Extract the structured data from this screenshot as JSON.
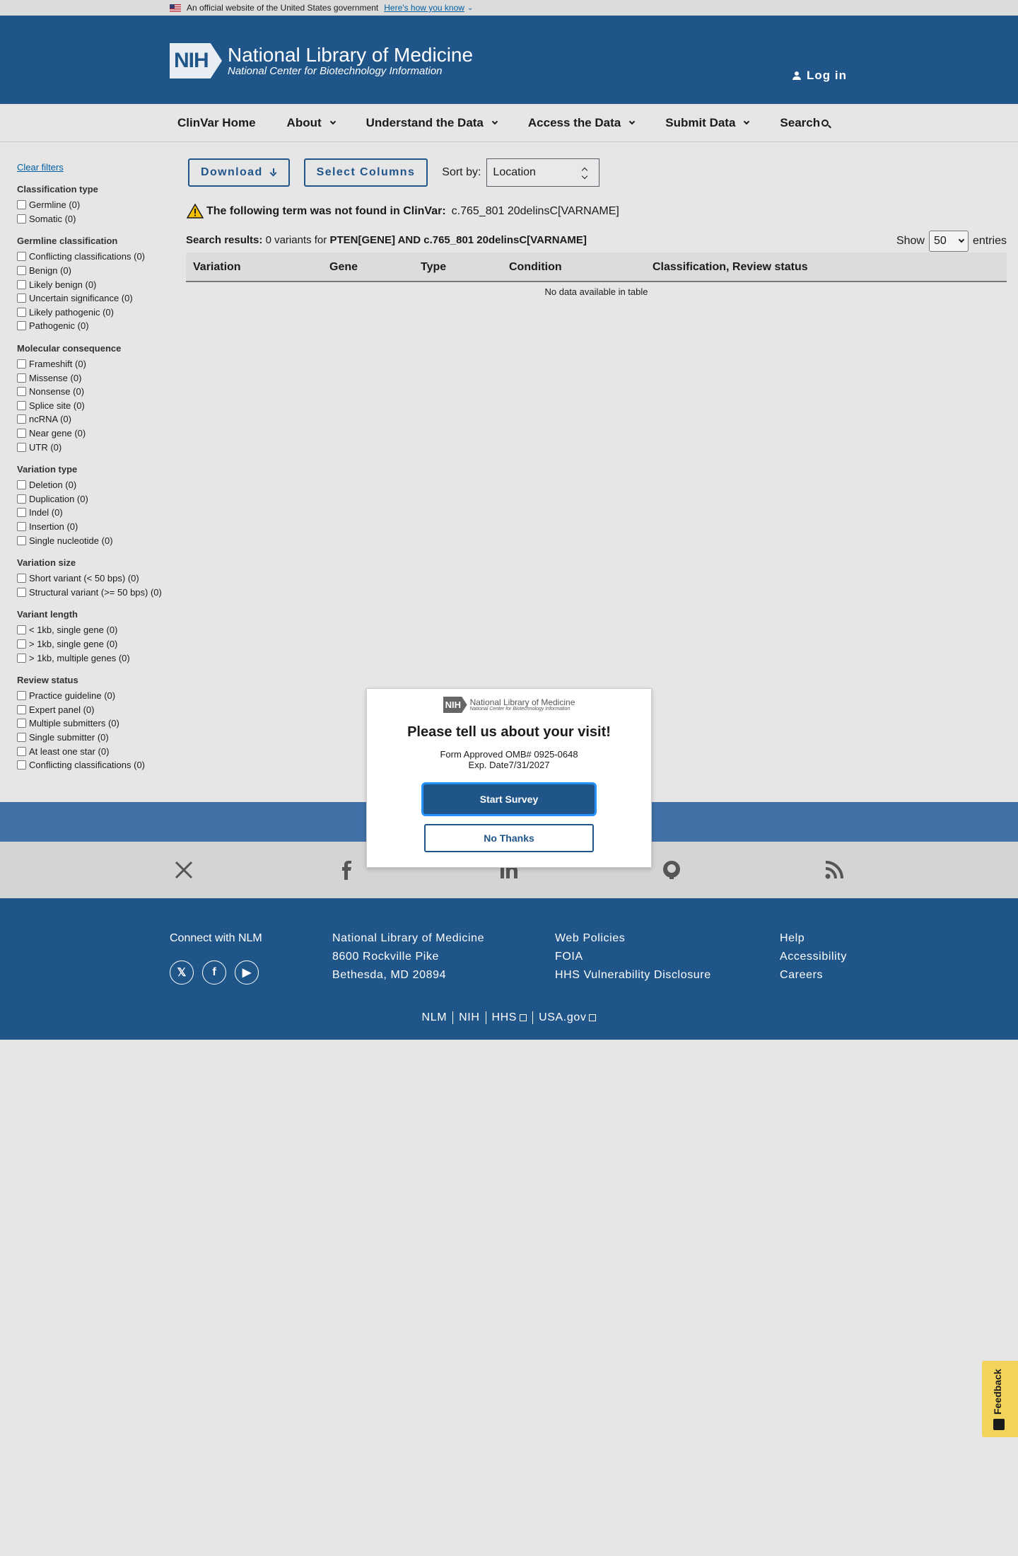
{
  "gov_banner": {
    "text": "An official website of the United States government",
    "link": "Here's how you know"
  },
  "header": {
    "logo_box": "NIH",
    "logo_title": "National Library of Medicine",
    "logo_subtitle": "National Center for Biotechnology Information",
    "login": "Log in"
  },
  "nav": {
    "items": [
      {
        "label": "ClinVar Home",
        "dropdown": false
      },
      {
        "label": "About",
        "dropdown": true
      },
      {
        "label": "Understand the Data",
        "dropdown": true
      },
      {
        "label": "Access the Data",
        "dropdown": true
      },
      {
        "label": "Submit Data",
        "dropdown": true
      },
      {
        "label": "Search",
        "icon": "search-icon"
      }
    ]
  },
  "sidebar": {
    "clear_filters": "Clear filters",
    "groups": [
      {
        "title": "Classification type",
        "options": [
          "Germline (0)",
          "Somatic (0)"
        ]
      },
      {
        "title": "Germline classification",
        "options": [
          "Conflicting classifications (0)",
          "Benign (0)",
          "Likely benign (0)",
          "Uncertain significance (0)",
          "Likely pathogenic (0)",
          "Pathogenic (0)"
        ]
      },
      {
        "title": "Molecular consequence",
        "options": [
          "Frameshift (0)",
          "Missense (0)",
          "Nonsense (0)",
          "Splice site (0)",
          "ncRNA (0)",
          "Near gene (0)",
          "UTR (0)"
        ]
      },
      {
        "title": "Variation type",
        "options": [
          "Deletion (0)",
          "Duplication (0)",
          "Indel (0)",
          "Insertion (0)",
          "Single nucleotide (0)"
        ]
      },
      {
        "title": "Variation size",
        "options": [
          "Short variant (< 50 bps) (0)",
          "Structural variant (>= 50 bps) (0)"
        ]
      },
      {
        "title": "Variant length",
        "options": [
          "< 1kb, single gene (0)",
          "> 1kb, single gene (0)",
          "> 1kb, multiple genes (0)"
        ]
      },
      {
        "title": "Review status",
        "options": [
          "Practice guideline (0)",
          "Expert panel (0)",
          "Multiple submitters (0)",
          "Single submitter (0)",
          "At least one star (0)",
          "Conflicting classifications (0)"
        ]
      }
    ]
  },
  "toolbar": {
    "download": "Download",
    "select_columns": "Select Columns",
    "sort_label": "Sort by:",
    "sort_value": "Location"
  },
  "warning": {
    "bold": "The following term was not found in ClinVar:",
    "term": "c.765_801 20delinsC[VARNAME]"
  },
  "results": {
    "label": "Search results:",
    "count_text": "0 variants for",
    "query": "PTEN[GENE] AND c.765_801 20delinsC[VARNAME]"
  },
  "show": {
    "prefix": "Show",
    "value": "50",
    "suffix": "entries"
  },
  "table": {
    "columns": [
      "Variation",
      "Gene",
      "Type",
      "Condition",
      "Classification, Review status"
    ],
    "empty": "No data available in table"
  },
  "survey": {
    "logo_box": "NIH",
    "logo_title": "National Library of Medicine",
    "logo_subtitle": "National Center for Biotechnology Information",
    "title": "Please tell us about your visit!",
    "form_line1": "Form Approved OMB# 0925-0648",
    "form_line2": "Exp. Date7/31/2027",
    "start": "Start Survey",
    "no": "No Thanks"
  },
  "footer": {
    "connect": "Connect with NLM",
    "address": [
      "National Library of Medicine",
      "8600 Rockville Pike",
      "Bethesda, MD 20894"
    ],
    "policies": [
      "Web Policies",
      "FOIA",
      "HHS Vulnerability Disclosure"
    ],
    "help": [
      "Help",
      "Accessibility",
      "Careers"
    ],
    "bottom": [
      "NLM",
      "NIH",
      "HHS",
      "USA.gov"
    ]
  },
  "feedback": "Feedback",
  "colors": {
    "header": "#20558a",
    "band": "#4271a8",
    "link": "#005ea2",
    "feedback": "#f2d35c"
  }
}
